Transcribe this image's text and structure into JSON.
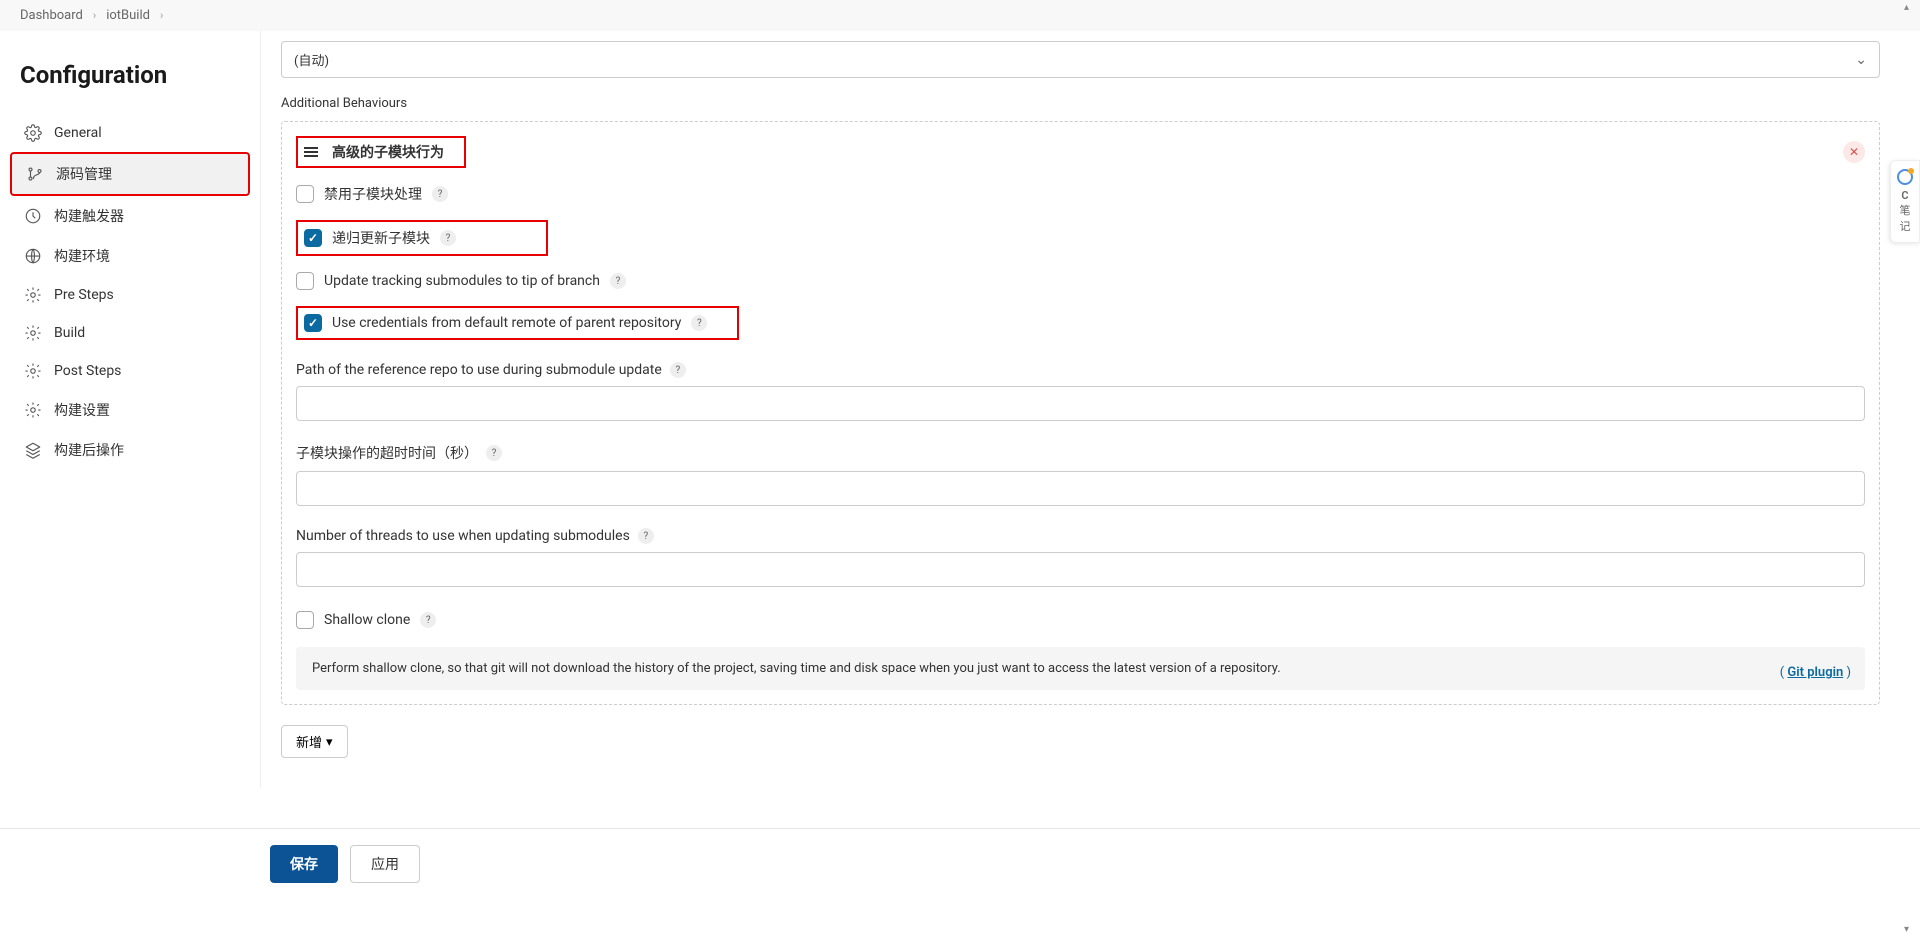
{
  "breadcrumb": {
    "dashboard": "Dashboard",
    "project": "iotBuild"
  },
  "sidebar": {
    "title": "Configuration",
    "items": [
      {
        "label": "General"
      },
      {
        "label": "源码管理"
      },
      {
        "label": "构建触发器"
      },
      {
        "label": "构建环境"
      },
      {
        "label": "Pre Steps"
      },
      {
        "label": "Build"
      },
      {
        "label": "Post Steps"
      },
      {
        "label": "构建设置"
      },
      {
        "label": "构建后操作"
      }
    ]
  },
  "content": {
    "select_value": "(自动)",
    "additional_behaviours_label": "Additional Behaviours",
    "panel_title": "高级的子模块行为",
    "options": {
      "disable_submodule": "禁用子模块处理",
      "recursive_update": "递归更新子模块",
      "update_tracking": "Update tracking submodules to tip of branch",
      "use_credentials": "Use credentials from default remote of parent repository",
      "shallow_clone": "Shallow clone"
    },
    "fields": {
      "reference_repo": "Path of the reference repo to use during submodule update",
      "timeout": "子模块操作的超时时间（秒）",
      "threads": "Number of threads to use when updating submodules"
    },
    "info_text": "Perform shallow clone, so that git will not download the history of the project, saving time and disk space when you just want to access the latest version of a repository.",
    "plugin_link": "Git plugin",
    "add_btn": "新增"
  },
  "footer": {
    "save": "保存",
    "apply": "应用"
  },
  "note_widget": {
    "icon_letter": "C",
    "label": "笔记"
  }
}
